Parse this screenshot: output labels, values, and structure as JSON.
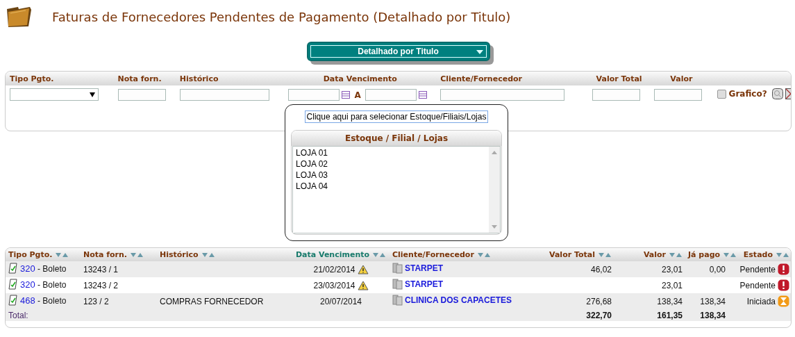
{
  "page": {
    "title": "Faturas de Fornecedores Pendentes de Pagamento (Detalhado por Titulo)"
  },
  "view_select": {
    "value": "Detalhado por Titulo"
  },
  "filters": {
    "fields": [
      {
        "kind": "select",
        "label": "Tipo Pgto."
      },
      {
        "kind": "text",
        "label": "Nota forn."
      },
      {
        "kind": "text",
        "label": "Histórico"
      },
      {
        "kind": "date_range",
        "label": "Data Vencimento",
        "separator": "A"
      },
      {
        "kind": "text",
        "label": "Cliente/Fornecedor"
      },
      {
        "kind": "text",
        "label": "Valor Total"
      },
      {
        "kind": "text",
        "label": "Valor"
      },
      {
        "kind": "checkbox",
        "label": "Grafico?",
        "checked": false
      }
    ],
    "store_button": "Clique aqui para selecionar Estoque/Filiais/Lojas"
  },
  "store_panel": {
    "title": "Estoque / Filial / Lojas",
    "items": [
      "LOJA 01",
      "LOJA 02",
      "LOJA 03",
      "LOJA 04"
    ]
  },
  "table": {
    "columns": [
      {
        "label": "Tipo Pgto.",
        "selected": false
      },
      {
        "label": "Nota forn.",
        "selected": false
      },
      {
        "label": "Histórico",
        "selected": false
      },
      {
        "label": "Data Vencimento",
        "selected": true
      },
      {
        "label": "Cliente/Fornecedor",
        "selected": false
      },
      {
        "label": "Valor Total",
        "selected": false
      },
      {
        "label": "Valor",
        "selected": false
      },
      {
        "label": "Já pago",
        "selected": false
      },
      {
        "label": "Estado",
        "selected": false
      }
    ],
    "rows": [
      {
        "code": "320",
        "type": " - Boleto",
        "note": "13243 / 1",
        "history": "",
        "due": "21/02/2014",
        "overdue": true,
        "supplier": "STARPET",
        "total": "46,02",
        "value": "23,01",
        "paid": "0,00",
        "status": "Pendente",
        "kind": "pending"
      },
      {
        "code": "320",
        "type": " - Boleto",
        "note": "13243 / 2",
        "history": "",
        "due": "23/03/2014",
        "overdue": true,
        "supplier": "STARPET",
        "total": "",
        "value": "23,01",
        "paid": "",
        "status": "Pendente",
        "kind": "pending"
      },
      {
        "code": "468",
        "type": " - Boleto",
        "note": "123 / 2",
        "history": "COMPRAS FORNECEDOR",
        "due": "20/07/2014",
        "overdue": false,
        "supplier": "CLINICA DOS CAPACETES",
        "total": "276,68",
        "value": "138,34",
        "paid": "138,34",
        "status": "Iniciada",
        "kind": "started"
      }
    ],
    "totals": {
      "label": "Total:",
      "total": "322,70",
      "value": "161,35",
      "paid": "138,34"
    }
  }
}
